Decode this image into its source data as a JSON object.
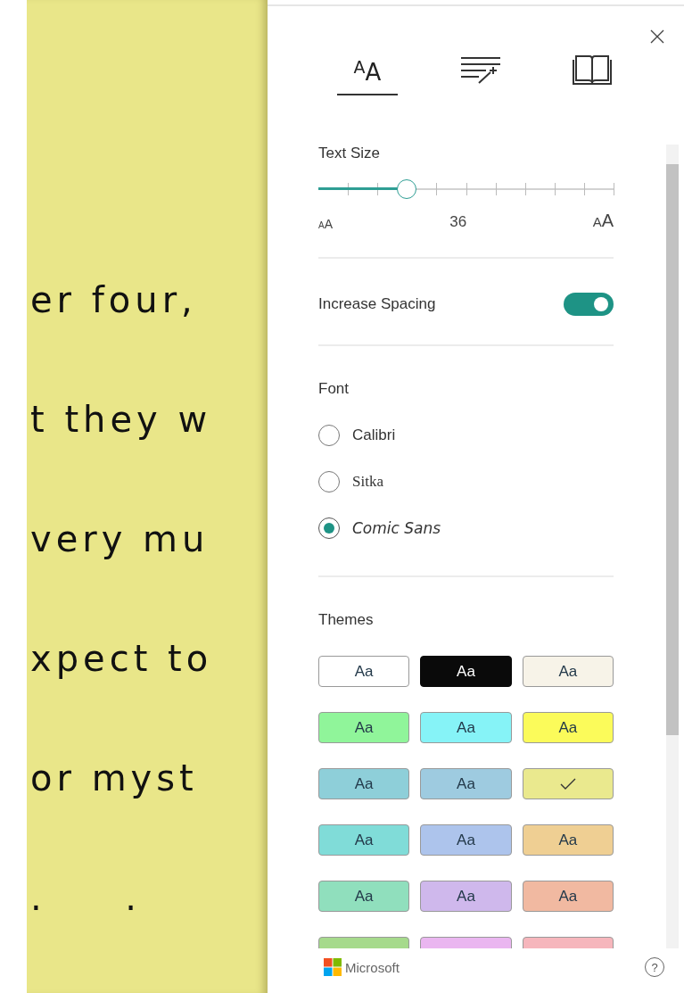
{
  "page": {
    "lines": [
      "er four,",
      "t they w",
      "very mu",
      "xpect to",
      "or myst",
      ".     ."
    ]
  },
  "panel": {
    "tabs": [
      {
        "kind": "text",
        "glyph": "$^{A}$A",
        "selected": true
      },
      {
        "kind": "lines-wand",
        "selected": false
      },
      {
        "kind": "book",
        "selected": false
      }
    ],
    "text_size": {
      "title": "Text Size",
      "level": 0.3,
      "min_label": "AA",
      "value": "36",
      "max_label": "AA"
    },
    "spacing": {
      "label": "Increase Spacing",
      "on": true
    },
    "font": {
      "title": "Font",
      "options": [
        {
          "label": "Calibri",
          "kind": "sans",
          "selected": false
        },
        {
          "label": "Sitka",
          "kind": "serif",
          "selected": false
        },
        {
          "label": "Comic Sans",
          "kind": "comic",
          "selected": true
        }
      ]
    },
    "themes": {
      "title": "Themes",
      "items": [
        {
          "label": "Aa",
          "color": "#ffffff",
          "selected": false
        },
        {
          "label": "Aa",
          "color": "#0a0a0a",
          "selected": false
        },
        {
          "label": "Aa",
          "color": "#f7f3e8",
          "selected": false
        },
        {
          "label": "Aa",
          "color": "#90f59a",
          "selected": false
        },
        {
          "label": "Aa",
          "color": "#86f3f7",
          "selected": false
        },
        {
          "label": "Aa",
          "color": "#fbfb5a",
          "selected": false
        },
        {
          "label": "Aa",
          "color": "#8ecfd9",
          "selected": false
        },
        {
          "label": "Aa",
          "color": "#9ecbe0",
          "selected": false
        },
        {
          "color": "#eae98e",
          "selected": true
        },
        {
          "label": "Aa",
          "color": "#80dcd8",
          "selected": false
        },
        {
          "label": "Aa",
          "color": "#adc4ec",
          "selected": false
        },
        {
          "label": "Aa",
          "color": "#efcf93",
          "selected": false
        },
        {
          "label": "Aa",
          "color": "#90dfbd",
          "selected": false
        },
        {
          "label": "Aa",
          "color": "#cfb8ec",
          "selected": false
        },
        {
          "label": "Aa",
          "color": "#f1b9a1",
          "selected": false
        },
        {
          "color": "#a6da8c",
          "selected": false
        },
        {
          "color": "#eab6f0",
          "selected": false
        },
        {
          "color": "#f6b6bc",
          "selected": false
        }
      ]
    },
    "footer": {
      "brand": "Microsoft",
      "help": "?"
    }
  }
}
